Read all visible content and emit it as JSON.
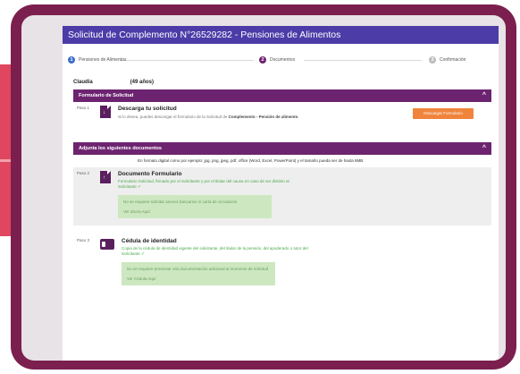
{
  "title": "Solicitud de Complemento N°26529282 - Pensiones de Alimentos",
  "steps": [
    {
      "num": "1",
      "label": "Pensiones de Alimentos",
      "color": "#3d6ec9"
    },
    {
      "num": "2",
      "label": "Documentos",
      "color": "#6d2470"
    },
    {
      "num": "3",
      "label": "Confirmación",
      "color": "#bdbdbd"
    }
  ],
  "user": {
    "name": "Claudia",
    "age": "(49 años)"
  },
  "formulario": {
    "header": "Formulario de Solicitud",
    "paso": "Paso 1",
    "title": "Descarga tu solicitud",
    "text_pre": "Si lo desea, puedes descargar el formulario de la Solicitud de ",
    "text_strong": "Complemento - Pensión de alimento",
    "text_post": ".",
    "button": "Descargar Formulario"
  },
  "adjunta": {
    "header": "Adjunta los siguientes documentos",
    "note": "En formato digital como por ejemplo: jpg, png, jpeg, pdf, office (Word, Excel, PowerPoint) y el tamaño pueda ser de hasta 8MB"
  },
  "doc1": {
    "paso": "Paso 2",
    "title": "Documento Formulario",
    "green": "Formulario Solicitud, firmado por el Solicitante y por el titular del causa en caso de ser distinto al Solicitante",
    "box1": "No se requiere solicitar anexos bancarios ni carta de circulación",
    "box2": "Ver ahora Aquí"
  },
  "doc2": {
    "paso": "Paso 3",
    "title": "Cédula de identidad",
    "green": "Copia de la cédula de identidad vigente del solicitante, del titular de la pensión, del apoderado o tutor del Solicitante",
    "box1": "No se requiere presentar otra documentación adicional al momento de solicitud",
    "box2": "Ver Cédula Aquí"
  },
  "colors": {
    "device": "#7b1f4f",
    "title_bar": "#4b3ca8",
    "section_header": "#6d2470",
    "button": "#f0843c",
    "green_box": "#cde7c0"
  }
}
